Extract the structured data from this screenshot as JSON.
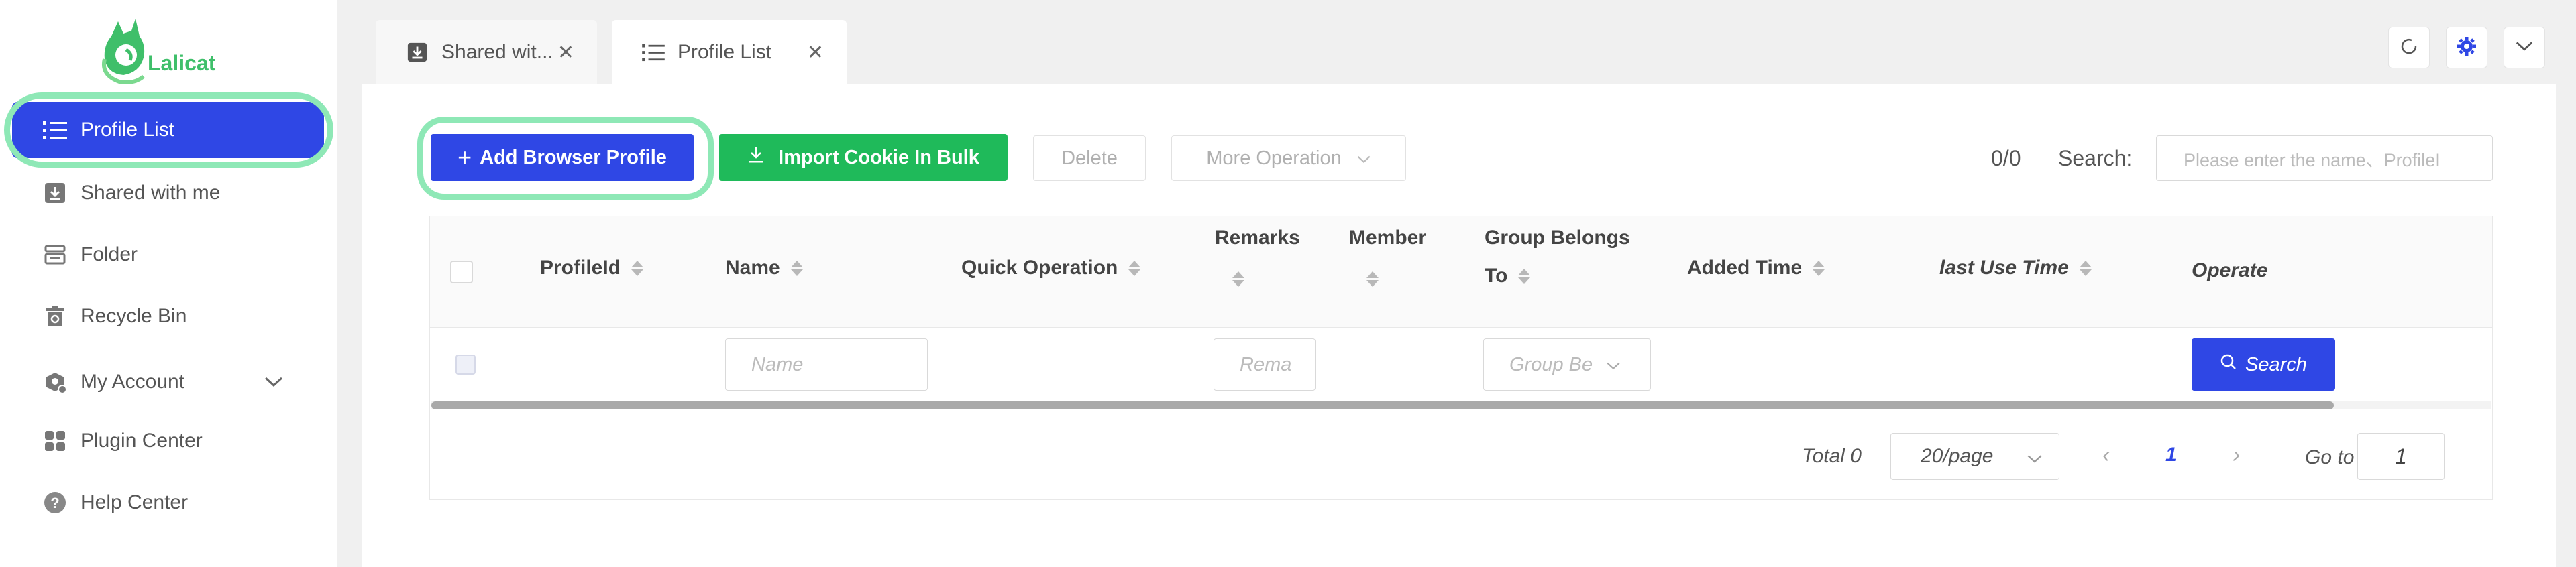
{
  "app": {
    "brand": "Lalicat"
  },
  "sidebar": {
    "items": [
      {
        "label": "Profile List",
        "icon": "list-icon"
      },
      {
        "label": "Shared with me",
        "icon": "download-box-icon"
      },
      {
        "label": "Folder",
        "icon": "folder-icon"
      },
      {
        "label": "Recycle Bin",
        "icon": "recycle-bin-icon"
      },
      {
        "label": "My Account",
        "icon": "account-icon"
      },
      {
        "label": "Plugin Center",
        "icon": "plugin-icon"
      },
      {
        "label": "Help Center",
        "icon": "help-icon"
      }
    ]
  },
  "tabs": [
    {
      "label": "Shared wit...",
      "icon": "download-box-icon"
    },
    {
      "label": "Profile List",
      "icon": "list-icon"
    }
  ],
  "toolbar": {
    "add_label": "Add Browser Profile",
    "import_label": "Import Cookie In Bulk",
    "delete_label": "Delete",
    "more_label": "More Operation",
    "count": "0/0",
    "search_label": "Search:",
    "search_placeholder": "Please enter the name、ProfileI"
  },
  "table": {
    "headers": {
      "profile_id": "ProfileId",
      "name": "Name",
      "quick_operation": "Quick Operation",
      "remarks": "Remarks",
      "member": "Member",
      "group_line1": "Group Belongs",
      "group_line2": "To",
      "added_time": "Added Time",
      "last_use_time": "last Use Time",
      "operate": "Operate"
    },
    "filters": {
      "name_placeholder": "Name",
      "remarks_placeholder": "Rema",
      "group_placeholder": "Group Be",
      "search_button": "Search"
    }
  },
  "pagination": {
    "total": "Total 0",
    "page_size": "20/page",
    "current_page": "1",
    "goto_label": "Go to",
    "goto_value": "1"
  },
  "colors": {
    "primary": "#2f47e5",
    "green": "#1fba5a",
    "highlight": "#8ee8b6",
    "brand": "#3fbf6a"
  }
}
